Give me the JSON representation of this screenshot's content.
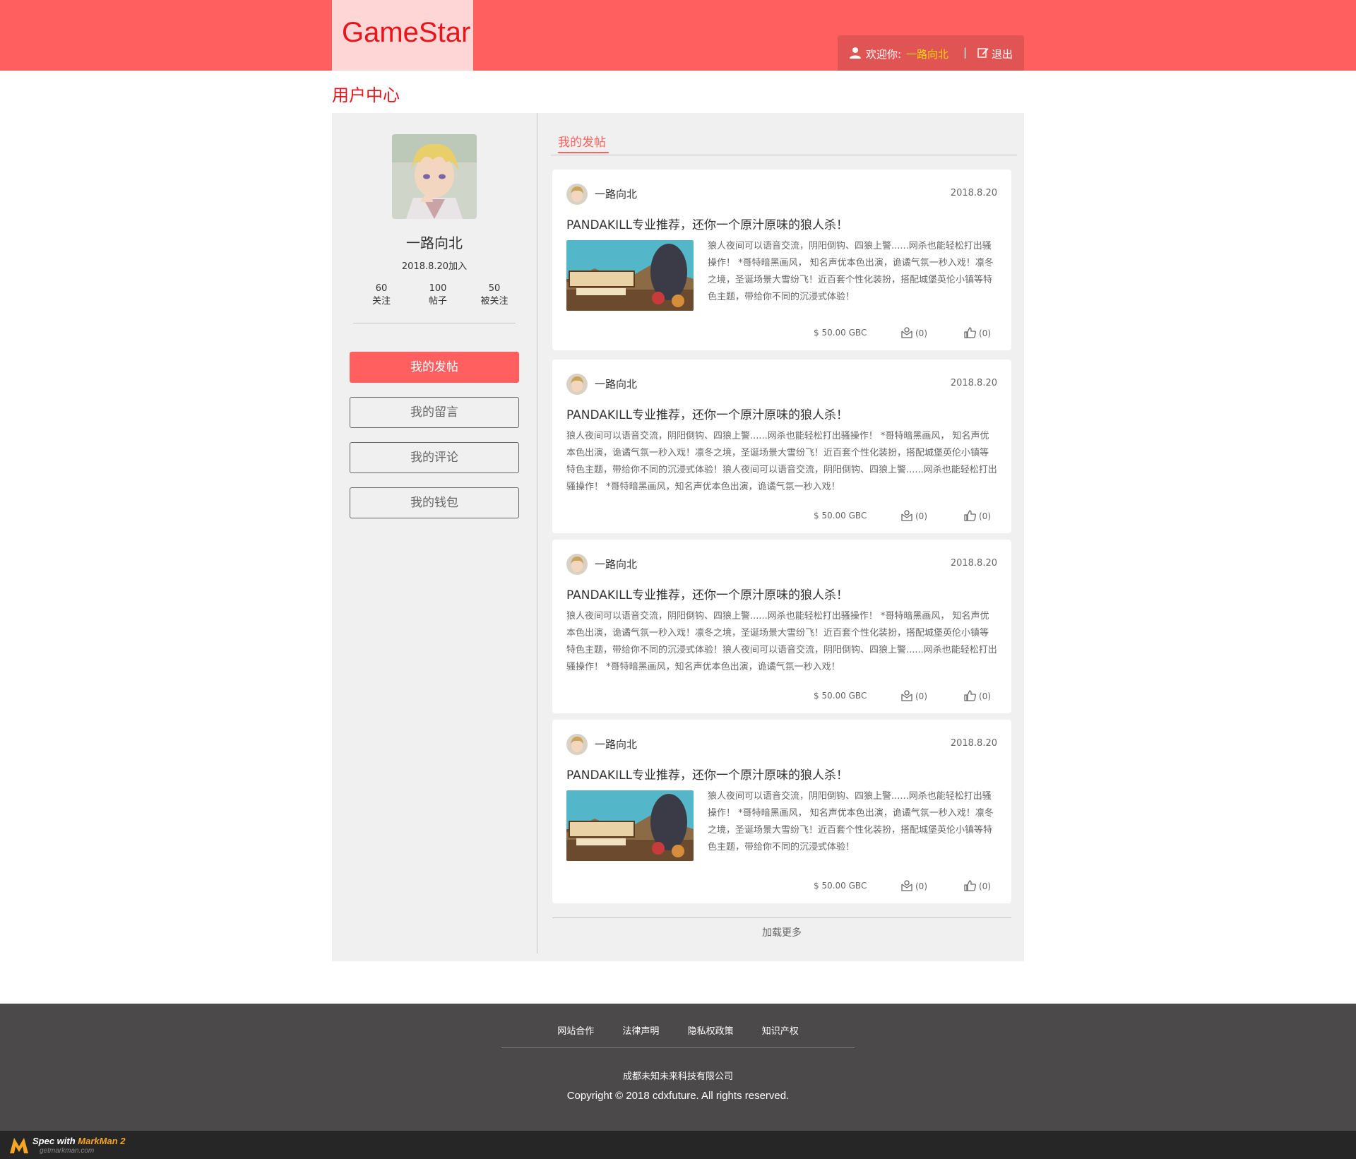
{
  "header": {
    "logo": "GameStar",
    "welcome_label": "欢迎你:",
    "username": "一路向北",
    "separator": "|",
    "logout_label": "退出"
  },
  "page_heading": "用户中心",
  "profile": {
    "name": "一路向北",
    "joined": "2018.8.20加入",
    "stats": [
      {
        "value": "60",
        "label": "关注"
      },
      {
        "value": "100",
        "label": "帖子"
      },
      {
        "value": "50",
        "label": "被关注"
      }
    ]
  },
  "nav": {
    "posts": "我的发帖",
    "messages": "我的留言",
    "comments": "我的评论",
    "wallet": "我的钱包"
  },
  "tab_title": "我的发帖",
  "posts": [
    {
      "author": "一路向北",
      "date": "2018.8.20",
      "title": "PANDAKILL专业推荐，还你一个原汁原味的狼人杀！",
      "body": "狼人夜间可以语音交流，阴阳倒钩、四狼上警......网杀也能轻松打出骚操作！  *哥特暗黑画风， 知名声优本色出演，诡谲气氛一秒入戏！凛冬之境，圣诞场景大雪纷飞！近百套个性化装扮，搭配城堡英伦小镇等特色主题，带给你不同的沉浸式体验！",
      "price": "$ 50.00 GBC",
      "messages": "(0)",
      "likes": "(0)"
    },
    {
      "author": "一路向北",
      "date": "2018.8.20",
      "title": "PANDAKILL专业推荐，还你一个原汁原味的狼人杀！",
      "body": "狼人夜间可以语音交流，阴阳倒钩、四狼上警......网杀也能轻松打出骚操作！  *哥特暗黑画风， 知名声优本色出演，诡谲气氛一秒入戏！凛冬之境，圣诞场景大雪纷飞！近百套个性化装扮，搭配城堡英伦小镇等特色主题，带给你不同的沉浸式体验！狼人夜间可以语音交流，阴阳倒钩、四狼上警......网杀也能轻松打出骚操作！  *哥特暗黑画风，知名声优本色出演，诡谲气氛一秒入戏！",
      "price": "$ 50.00 GBC",
      "messages": "(0)",
      "likes": "(0)"
    },
    {
      "author": "一路向北",
      "date": "2018.8.20",
      "title": "PANDAKILL专业推荐，还你一个原汁原味的狼人杀！",
      "body": "狼人夜间可以语音交流，阴阳倒钩、四狼上警......网杀也能轻松打出骚操作！  *哥特暗黑画风， 知名声优本色出演，诡谲气氛一秒入戏！凛冬之境，圣诞场景大雪纷飞！近百套个性化装扮，搭配城堡英伦小镇等特色主题，带给你不同的沉浸式体验！狼人夜间可以语音交流，阴阳倒钩、四狼上警......网杀也能轻松打出骚操作！  *哥特暗黑画风，知名声优本色出演，诡谲气氛一秒入戏！",
      "price": "$ 50.00 GBC",
      "messages": "(0)",
      "likes": "(0)"
    },
    {
      "author": "一路向北",
      "date": "2018.8.20",
      "title": "PANDAKILL专业推荐，还你一个原汁原味的狼人杀！",
      "body": "狼人夜间可以语音交流，阴阳倒钩、四狼上警......网杀也能轻松打出骚操作！  *哥特暗黑画风， 知名声优本色出演，诡谲气氛一秒入戏！凛冬之境，圣诞场景大雪纷飞！近百套个性化装扮，搭配城堡英伦小镇等特色主题，带给你不同的沉浸式体验！",
      "price": "$ 50.00 GBC",
      "messages": "(0)",
      "likes": "(0)"
    }
  ],
  "load_more": "加载更多",
  "footer": {
    "links": [
      "网站合作",
      "法律声明",
      "隐私权政策",
      "知识产权"
    ],
    "company": "成都未知未来科技有限公司",
    "copyright": "Copyright © 2018 cdxfuture. All rights reserved."
  },
  "markman": {
    "prefix": "Spec with ",
    "brand": "MarkMan 2",
    "url": "getmarkman.com"
  },
  "colors": {
    "brand_red": "#ff605f",
    "username_yellow": "#fad60b",
    "footer_bg": "#4b4949"
  },
  "icons": [
    "user-icon",
    "edit-icon",
    "message-icon",
    "like-icon"
  ]
}
